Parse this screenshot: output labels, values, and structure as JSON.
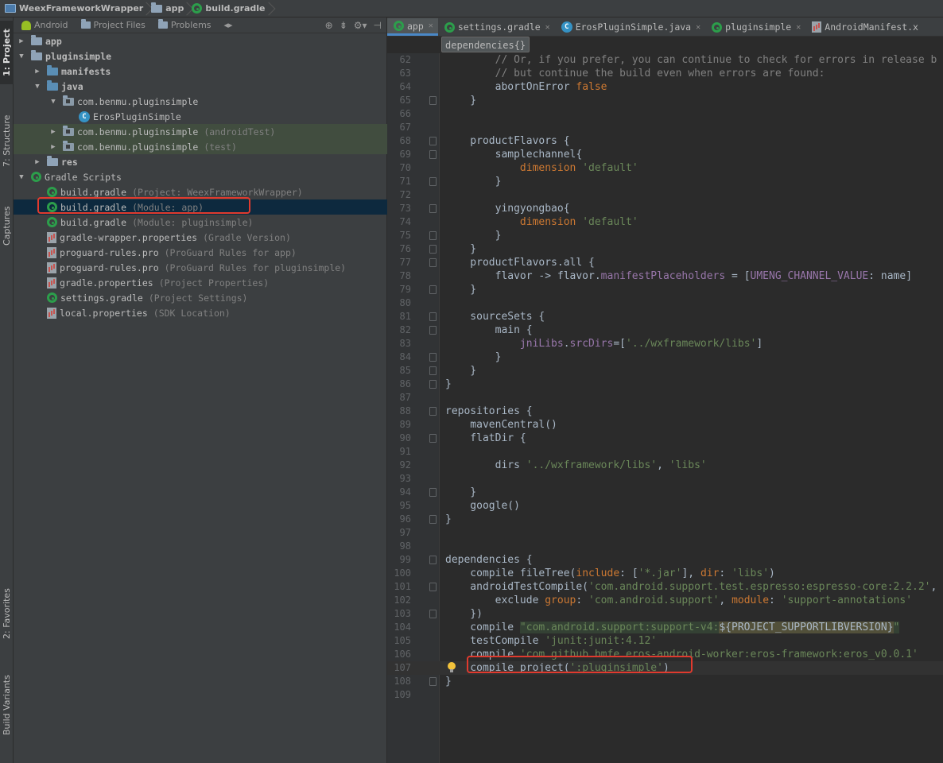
{
  "breadcrumb": [
    {
      "label": "WeexFrameworkWrapper",
      "icon": "project-icon"
    },
    {
      "label": "app",
      "icon": "folder-icon"
    },
    {
      "label": "build.gradle",
      "icon": "gradle-icon"
    }
  ],
  "left_strip": {
    "project": "1: Project",
    "structure": "7: Structure",
    "captures": "Captures",
    "favorites": "2: Favorites",
    "build_variants": "Build Variants"
  },
  "project_toolbar": {
    "tabs": [
      "Android",
      "Project Files",
      "Problems"
    ]
  },
  "tree": [
    {
      "indent": 0,
      "arrow": "right",
      "icon": "folder",
      "label": "app",
      "hint": "",
      "bold": true
    },
    {
      "indent": 0,
      "arrow": "down",
      "icon": "folder",
      "label": "pluginsimple",
      "hint": "",
      "bold": true
    },
    {
      "indent": 1,
      "arrow": "right",
      "icon": "folder-blue",
      "label": "manifests",
      "hint": "",
      "bold": true
    },
    {
      "indent": 1,
      "arrow": "down",
      "icon": "folder-blue",
      "label": "java",
      "hint": "",
      "bold": true
    },
    {
      "indent": 2,
      "arrow": "down",
      "icon": "package",
      "label": "com.benmu.pluginsimple",
      "hint": ""
    },
    {
      "indent": 3,
      "arrow": "",
      "icon": "class",
      "label": "ErosPluginSimple",
      "hint": ""
    },
    {
      "indent": 2,
      "arrow": "right",
      "icon": "package",
      "label": "com.benmu.pluginsimple",
      "hint": "(androidTest)",
      "highlight": true
    },
    {
      "indent": 2,
      "arrow": "right",
      "icon": "package",
      "label": "com.benmu.pluginsimple",
      "hint": "(test)",
      "highlight": true
    },
    {
      "indent": 1,
      "arrow": "right",
      "icon": "folder",
      "label": "res",
      "hint": "",
      "bold": true
    },
    {
      "indent": 0,
      "arrow": "down",
      "icon": "gradle",
      "label": "Gradle Scripts",
      "hint": ""
    },
    {
      "indent": 1,
      "arrow": "",
      "icon": "gradle",
      "label": "build.gradle",
      "hint": "(Project: WeexFrameworkWrapper)"
    },
    {
      "indent": 1,
      "arrow": "",
      "icon": "gradle",
      "label": "build.gradle",
      "hint": "(Module: app)",
      "selected": true
    },
    {
      "indent": 1,
      "arrow": "",
      "icon": "gradle",
      "label": "build.gradle",
      "hint": "(Module: pluginsimple)"
    },
    {
      "indent": 1,
      "arrow": "",
      "icon": "props",
      "label": "gradle-wrapper.properties",
      "hint": "(Gradle Version)"
    },
    {
      "indent": 1,
      "arrow": "",
      "icon": "props",
      "label": "proguard-rules.pro",
      "hint": "(ProGuard Rules for app)"
    },
    {
      "indent": 1,
      "arrow": "",
      "icon": "props",
      "label": "proguard-rules.pro",
      "hint": "(ProGuard Rules for pluginsimple)"
    },
    {
      "indent": 1,
      "arrow": "",
      "icon": "props",
      "label": "gradle.properties",
      "hint": "(Project Properties)"
    },
    {
      "indent": 1,
      "arrow": "",
      "icon": "gradle",
      "label": "settings.gradle",
      "hint": "(Project Settings)"
    },
    {
      "indent": 1,
      "arrow": "",
      "icon": "props",
      "label": "local.properties",
      "hint": "(SDK Location)"
    }
  ],
  "editor_tabs": [
    {
      "label": "app",
      "icon": "gradle",
      "active": true
    },
    {
      "label": "settings.gradle",
      "icon": "gradle"
    },
    {
      "label": "ErosPluginSimple.java",
      "icon": "class"
    },
    {
      "label": "pluginsimple",
      "icon": "gradle"
    },
    {
      "label": "AndroidManifest.x",
      "icon": "manifest"
    }
  ],
  "code_crumb": "dependencies{}",
  "code_lines": [
    {
      "n": "62",
      "fold": false,
      "parts": [
        [
          "        // Or, if you prefer, you can continue to check for errors in release b",
          "cm"
        ]
      ]
    },
    {
      "n": "63",
      "fold": false,
      "parts": [
        [
          "        // but continue the build even when errors are found:",
          "cm"
        ]
      ]
    },
    {
      "n": "64",
      "fold": false,
      "parts": [
        [
          "        abortOnError ",
          ""
        ],
        [
          "false",
          "kw"
        ]
      ]
    },
    {
      "n": "65",
      "fold": true,
      "parts": [
        [
          "    }",
          ""
        ]
      ]
    },
    {
      "n": "66",
      "fold": false,
      "parts": []
    },
    {
      "n": "67",
      "fold": false,
      "parts": []
    },
    {
      "n": "68",
      "fold": true,
      "parts": [
        [
          "    productFlavors {",
          ""
        ]
      ]
    },
    {
      "n": "69",
      "fold": true,
      "parts": [
        [
          "        samplechannel{",
          ""
        ]
      ]
    },
    {
      "n": "70",
      "fold": false,
      "parts": [
        [
          "            ",
          ""
        ],
        [
          "dimension",
          "kw"
        ],
        [
          " ",
          ""
        ],
        [
          "'default'",
          "str"
        ]
      ]
    },
    {
      "n": "71",
      "fold": true,
      "parts": [
        [
          "        }",
          ""
        ]
      ]
    },
    {
      "n": "72",
      "fold": false,
      "parts": []
    },
    {
      "n": "73",
      "fold": true,
      "parts": [
        [
          "        yingyongbao{",
          ""
        ]
      ]
    },
    {
      "n": "74",
      "fold": false,
      "parts": [
        [
          "            ",
          ""
        ],
        [
          "dimension",
          "kw"
        ],
        [
          " ",
          ""
        ],
        [
          "'default'",
          "str"
        ]
      ]
    },
    {
      "n": "75",
      "fold": true,
      "parts": [
        [
          "        }",
          ""
        ]
      ]
    },
    {
      "n": "76",
      "fold": true,
      "parts": [
        [
          "    }",
          ""
        ]
      ]
    },
    {
      "n": "77",
      "fold": true,
      "parts": [
        [
          "    productFlavors.all {",
          ""
        ]
      ]
    },
    {
      "n": "78",
      "fold": false,
      "parts": [
        [
          "        flavor -> flavor.",
          ""
        ],
        [
          "manifestPlaceholders",
          "prop"
        ],
        [
          " = [",
          ""
        ],
        [
          "UMENG_CHANNEL_VALUE",
          "prop"
        ],
        [
          ": name]",
          ""
        ]
      ]
    },
    {
      "n": "79",
      "fold": true,
      "parts": [
        [
          "    }",
          ""
        ]
      ]
    },
    {
      "n": "80",
      "fold": false,
      "parts": []
    },
    {
      "n": "81",
      "fold": true,
      "parts": [
        [
          "    sourceSets {",
          ""
        ]
      ]
    },
    {
      "n": "82",
      "fold": true,
      "parts": [
        [
          "        main {",
          ""
        ]
      ]
    },
    {
      "n": "83",
      "fold": false,
      "parts": [
        [
          "            ",
          ""
        ],
        [
          "jniLibs",
          "prop"
        ],
        [
          ".",
          ""
        ],
        [
          "srcDirs",
          "prop"
        ],
        [
          "=[",
          ""
        ],
        [
          "'../wxframework/libs'",
          "str"
        ],
        [
          "]",
          ""
        ]
      ]
    },
    {
      "n": "84",
      "fold": true,
      "parts": [
        [
          "        }",
          ""
        ]
      ]
    },
    {
      "n": "85",
      "fold": true,
      "parts": [
        [
          "    }",
          ""
        ]
      ]
    },
    {
      "n": "86",
      "fold": true,
      "parts": [
        [
          "}",
          ""
        ]
      ]
    },
    {
      "n": "87",
      "fold": false,
      "parts": []
    },
    {
      "n": "88",
      "fold": true,
      "parts": [
        [
          "repositories {",
          ""
        ]
      ]
    },
    {
      "n": "89",
      "fold": false,
      "parts": [
        [
          "    mavenCentral()",
          ""
        ]
      ]
    },
    {
      "n": "90",
      "fold": true,
      "parts": [
        [
          "    flatDir {",
          ""
        ]
      ]
    },
    {
      "n": "91",
      "fold": false,
      "parts": []
    },
    {
      "n": "92",
      "fold": false,
      "parts": [
        [
          "        dirs ",
          ""
        ],
        [
          "'../wxframework/libs'",
          "str"
        ],
        [
          ", ",
          ""
        ],
        [
          "'libs'",
          "str"
        ]
      ]
    },
    {
      "n": "93",
      "fold": false,
      "parts": []
    },
    {
      "n": "94",
      "fold": true,
      "parts": [
        [
          "    }",
          ""
        ]
      ]
    },
    {
      "n": "95",
      "fold": false,
      "parts": [
        [
          "    google()",
          ""
        ]
      ]
    },
    {
      "n": "96",
      "fold": true,
      "parts": [
        [
          "}",
          ""
        ]
      ]
    },
    {
      "n": "97",
      "fold": false,
      "parts": []
    },
    {
      "n": "98",
      "fold": false,
      "parts": []
    },
    {
      "n": "99",
      "fold": true,
      "parts": [
        [
          "dependencies {",
          ""
        ]
      ]
    },
    {
      "n": "100",
      "fold": false,
      "parts": [
        [
          "    compile fileTree(",
          ""
        ],
        [
          "include",
          "kw"
        ],
        [
          ": [",
          ""
        ],
        [
          "'*.jar'",
          "str"
        ],
        [
          "], ",
          ""
        ],
        [
          "dir",
          "kw"
        ],
        [
          ": ",
          ""
        ],
        [
          "'libs'",
          "str"
        ],
        [
          ")",
          ""
        ]
      ]
    },
    {
      "n": "101",
      "fold": true,
      "parts": [
        [
          "    androidTestCompile(",
          ""
        ],
        [
          "'com.android.support.test.espresso:espresso-core:2.2.2'",
          "str"
        ],
        [
          ",",
          ""
        ]
      ]
    },
    {
      "n": "102",
      "fold": false,
      "parts": [
        [
          "        exclude ",
          ""
        ],
        [
          "group",
          "kw"
        ],
        [
          ": ",
          ""
        ],
        [
          "'com.android.support'",
          "str"
        ],
        [
          ", ",
          ""
        ],
        [
          "module",
          "kw"
        ],
        [
          ": ",
          ""
        ],
        [
          "'support-annotations'",
          "str"
        ]
      ]
    },
    {
      "n": "103",
      "fold": true,
      "parts": [
        [
          "    })",
          ""
        ]
      ]
    },
    {
      "n": "104",
      "fold": false,
      "parts": [
        [
          "    compile ",
          ""
        ],
        [
          "\"com.android.support:support-v4:",
          "str-hl"
        ],
        [
          "${PROJECT_SUPPORTLIBVERSION}",
          "inl"
        ],
        [
          "\"",
          "str-hl"
        ]
      ]
    },
    {
      "n": "105",
      "fold": false,
      "parts": [
        [
          "    testCompile ",
          ""
        ],
        [
          "'junit:junit:4.12'",
          "str"
        ]
      ]
    },
    {
      "n": "106",
      "fold": false,
      "parts": [
        [
          "    compile ",
          ""
        ],
        [
          "'com.github.bmfe.eros-android-worker:eros-framework:eros_v0.0.1'",
          "str"
        ]
      ]
    },
    {
      "n": "107",
      "fold": false,
      "caret": true,
      "bulb": true,
      "parts": [
        [
          "    compile project(",
          ""
        ],
        [
          "':pluginsimple'",
          "str"
        ],
        [
          ")",
          ""
        ]
      ]
    },
    {
      "n": "108",
      "fold": true,
      "parts": [
        [
          "}",
          ""
        ]
      ]
    },
    {
      "n": "109",
      "fold": false,
      "parts": []
    }
  ],
  "colors": {
    "editor_bg": "#2b2b2b",
    "panel_bg": "#3c3f41",
    "keyword": "#cc7832",
    "string": "#6a8759",
    "comment": "#808080",
    "annotation_box": "#e03a2e"
  }
}
